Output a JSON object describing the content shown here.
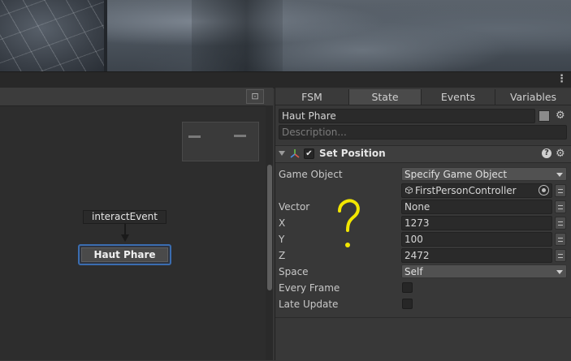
{
  "graph": {
    "event_label": "interactEvent",
    "state_label": "Haut Phare"
  },
  "inspector": {
    "tabs": [
      {
        "label": "FSM",
        "active": false
      },
      {
        "label": "State",
        "active": true
      },
      {
        "label": "Events",
        "active": false
      },
      {
        "label": "Variables",
        "active": false
      }
    ],
    "state_name": "Haut Phare",
    "description_placeholder": "Description...",
    "action": {
      "title": "Set Position",
      "enabled": true,
      "rows": {
        "game_object": {
          "label": "Game Object",
          "value": "Specify Game Object"
        },
        "object_ref": {
          "value": "FirstPersonController"
        },
        "vector": {
          "label": "Vector",
          "value": "None"
        },
        "x": {
          "label": "X",
          "value": "1273"
        },
        "y": {
          "label": "Y",
          "value": "100"
        },
        "z": {
          "label": "Z",
          "value": "2472"
        },
        "space": {
          "label": "Space",
          "value": "Self"
        },
        "every_frame": {
          "label": "Every Frame",
          "checked": false
        },
        "late_update": {
          "label": "Late Update",
          "checked": false
        }
      }
    }
  },
  "annotation": {
    "text": "?",
    "color": "#f2e600"
  },
  "colors": {
    "accent_node_border": "#3b6db0",
    "panel_bg": "#383838",
    "graph_bg": "#2d2d2d"
  }
}
